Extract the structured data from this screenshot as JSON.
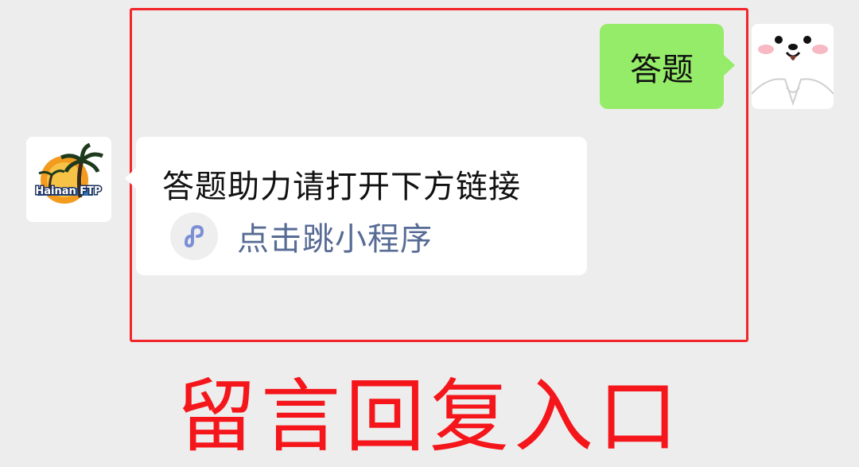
{
  "colors": {
    "background": "#ededed",
    "highlight_border": "#f2262a",
    "sent_bubble": "#95ec69",
    "received_bubble": "#ffffff",
    "link_text": "#576b95",
    "caption": "#f4161b"
  },
  "chat": {
    "sent_message": {
      "text": "答题",
      "avatar_icon": "bear-avatar-icon"
    },
    "received_message": {
      "text": "答题助力请打开下方链接",
      "link_icon": "mini-program-link-icon",
      "link_text": "点击跳小程序",
      "avatar_icon": "palm-sunset-logo-icon",
      "avatar_logo_text": "Hainan FTP"
    }
  },
  "caption": {
    "text": "留言回复入口"
  }
}
